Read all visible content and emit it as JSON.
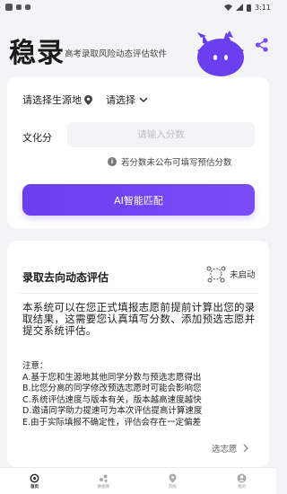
{
  "status_bar": {
    "time": "3:11"
  },
  "header": {
    "logo_text": "稳录",
    "subtitle": "高考录取风险动态评估软件"
  },
  "form": {
    "location_label": "请选择生源地",
    "select_label": "请选择",
    "score_label": "文化分",
    "score_placeholder": "请输入分数",
    "hint": "若分数未公布可填写预估分数",
    "ai_button": "AI智能匹配"
  },
  "evaluation": {
    "title": "录取去向动态评估",
    "status": "未启动",
    "description": "本系统可以在您正式填报志愿前提前计算出您的录取结果，这需要您认真填写分数、添加预选志愿并提交系统评估。",
    "notes_title": "注意：",
    "notes": [
      "A.基于您和生源地其他同学分数与预选志愿得出",
      "B.比您分高的同学修改预选志愿时可能会影响您",
      "C.系统评估速度与版本有关，版本越高速度越快",
      "D.邀请同学助力提速可为本次评估提高计算速度",
      "E.由于实际填报不确定性，评估会存在一定偏差"
    ],
    "footer_link": "选志愿"
  },
  "tabbar": {
    "items": [
      {
        "label": "首页",
        "icon": "home-icon"
      },
      {
        "label": "数据库",
        "icon": "database-icon"
      },
      {
        "label": "院校",
        "icon": "location-icon"
      },
      {
        "label": "我的",
        "icon": "user-icon"
      }
    ]
  },
  "colors": {
    "accent": "#6a3ff0",
    "share": "#7a4cf6"
  }
}
